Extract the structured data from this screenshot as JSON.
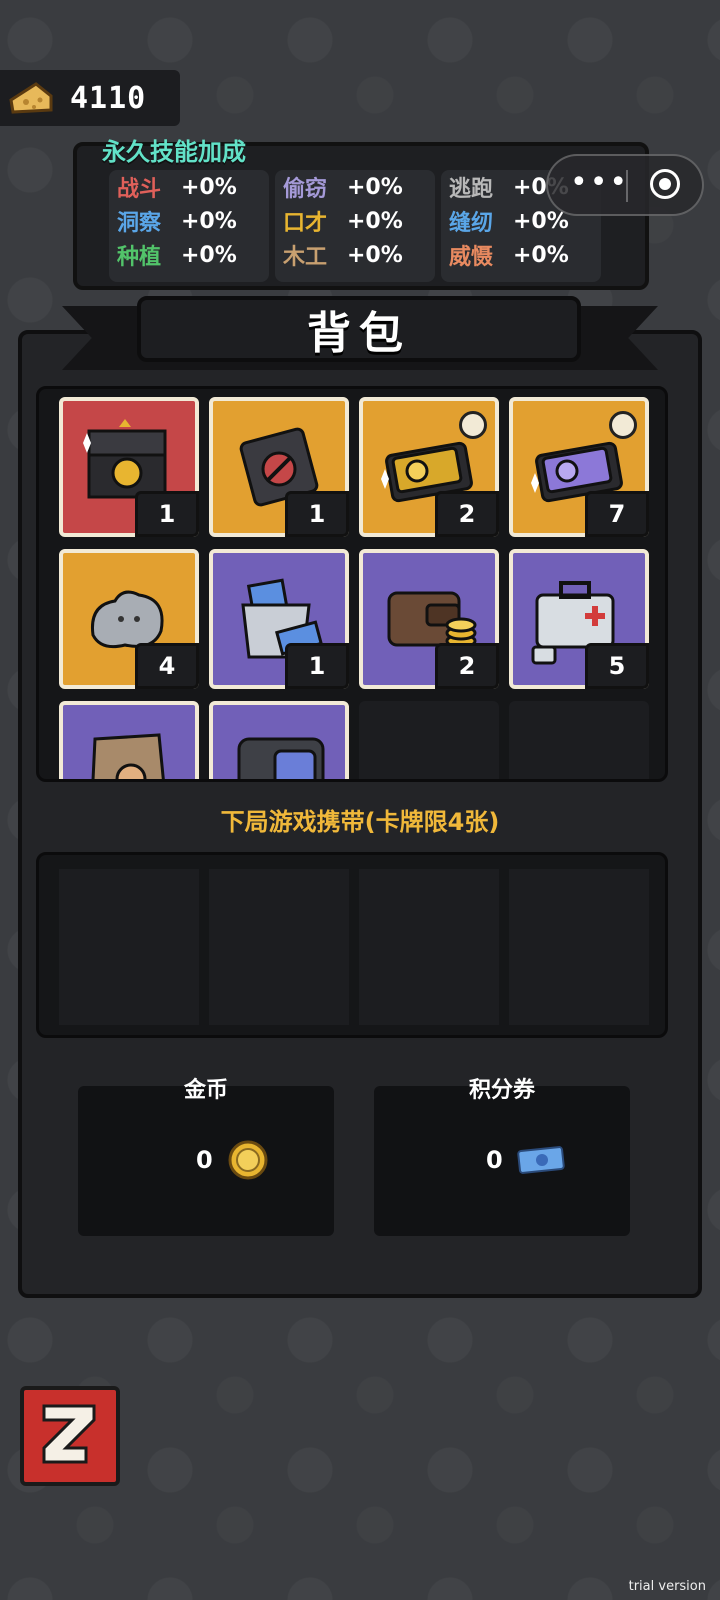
{
  "currency": {
    "cheese_amount": "4110",
    "icon": "cheese-icon"
  },
  "skills": {
    "title": "永久技能加成",
    "columns": [
      [
        {
          "name": "战斗",
          "value": "+0%",
          "color": "#e0605a"
        },
        {
          "name": "洞察",
          "value": "+0%",
          "color": "#5aa6e8"
        },
        {
          "name": "种植",
          "value": "+0%",
          "color": "#52c46a"
        }
      ],
      [
        {
          "name": "偷窃",
          "value": "+0%",
          "color": "#a59ad8"
        },
        {
          "name": "口才",
          "value": "+0%",
          "color": "#e8b530"
        },
        {
          "name": "木工",
          "value": "+0%",
          "color": "#c8a070"
        }
      ],
      [
        {
          "name": "逃跑",
          "value": "+0%",
          "color": "#b8b8b8"
        },
        {
          "name": "缝纫",
          "value": "+0%",
          "color": "#5aa6e8"
        },
        {
          "name": "威慑",
          "value": "+0%",
          "color": "#e88a60"
        }
      ]
    ]
  },
  "capsule": {
    "more_label": "•••",
    "close_icon": "target-icon"
  },
  "backpack": {
    "title": "背包"
  },
  "inventory": [
    {
      "name": "gift-box",
      "count": "1",
      "bg": "#c54748"
    },
    {
      "name": "sealed-box",
      "count": "1",
      "bg": "#e2a030"
    },
    {
      "name": "gold-card-pack",
      "count": "2",
      "bg": "#e2a030"
    },
    {
      "name": "purple-card-pack",
      "count": "7",
      "bg": "#e2a030"
    },
    {
      "name": "silver-mouse-ingot",
      "count": "4",
      "bg": "#e2a030"
    },
    {
      "name": "cash-bag",
      "count": "1",
      "bg": "#7160b8"
    },
    {
      "name": "wallet",
      "count": "2",
      "bg": "#7160b8"
    },
    {
      "name": "first-aid-kit",
      "count": "5",
      "bg": "#7160b8"
    },
    {
      "name": "sack",
      "count": "",
      "bg": "#7160b8"
    },
    {
      "name": "metal-box",
      "count": "",
      "bg": "#7160b8"
    }
  ],
  "carry": {
    "label": "下局游戏携带(卡牌限4张)"
  },
  "wallet_cards": [
    {
      "title": "金币",
      "value": "0",
      "icon": "gold-coin-icon"
    },
    {
      "title": "积分券",
      "value": "0",
      "icon": "ticket-icon"
    }
  ],
  "watermark": "trial version"
}
